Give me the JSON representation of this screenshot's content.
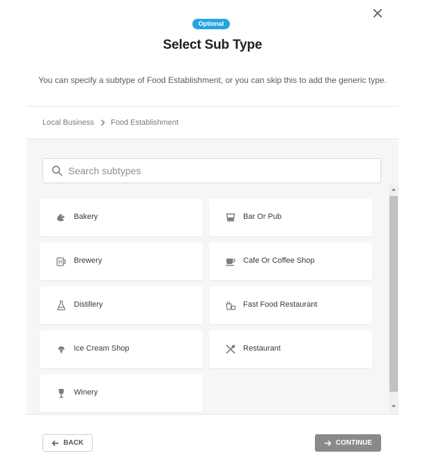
{
  "dialog": {
    "badge": "Optional",
    "title": "Select Sub Type",
    "subtitle": "You can specify a subtype of Food Establishment, or you can skip this to add the generic type.",
    "close_icon": "close-icon"
  },
  "breadcrumb": {
    "items": [
      "Local Business",
      "Food Establishment"
    ],
    "separator_icon": "chevron-right-icon"
  },
  "search": {
    "placeholder": "Search subtypes",
    "value": "",
    "icon": "search-icon"
  },
  "subtypes": [
    {
      "label": "Bakery",
      "icon": "croissant-icon"
    },
    {
      "label": "Bar Or Pub",
      "icon": "glass-icon"
    },
    {
      "label": "Brewery",
      "icon": "beer-mug-icon"
    },
    {
      "label": "Cafe Or Coffee Shop",
      "icon": "coffee-cup-icon"
    },
    {
      "label": "Distillery",
      "icon": "flask-icon"
    },
    {
      "label": "Fast Food Restaurant",
      "icon": "fast-food-icon"
    },
    {
      "label": "Ice Cream Shop",
      "icon": "ice-cream-icon"
    },
    {
      "label": "Restaurant",
      "icon": "utensils-icon"
    },
    {
      "label": "Winery",
      "icon": "wine-glass-icon"
    }
  ],
  "footer": {
    "back_label": "BACK",
    "continue_label": "CONTINUE"
  },
  "colors": {
    "badge": "#25a5e0",
    "continue_disabled": "#8a8a8a",
    "panel_bg": "#f6f6f6"
  }
}
